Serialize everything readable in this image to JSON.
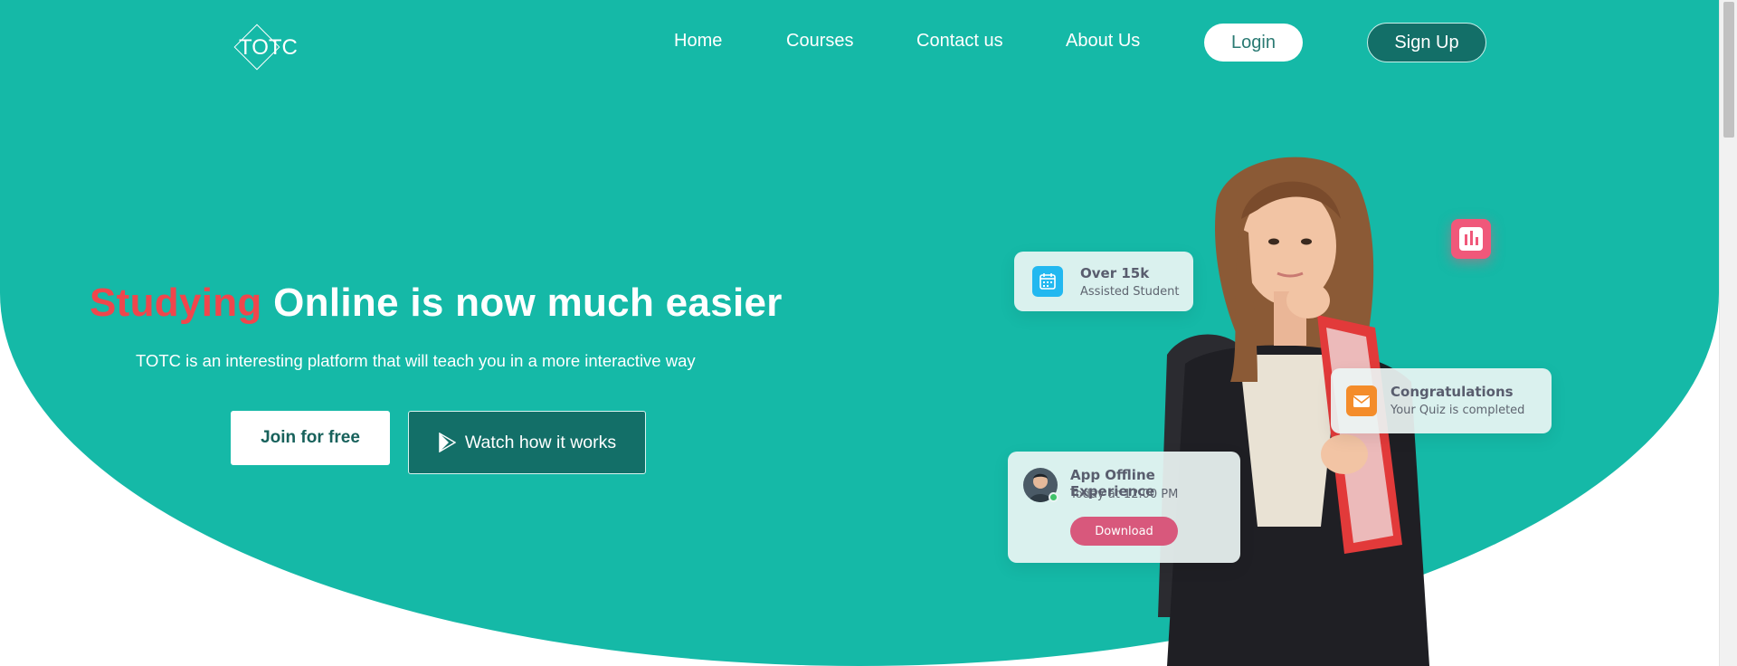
{
  "nav": {
    "logo_text": "TOTC",
    "links": [
      "Home",
      "Courses",
      "Contact us",
      "About Us"
    ],
    "login_label": "Login",
    "signup_label": "Sign Up"
  },
  "hero": {
    "headline_accent": "Studying",
    "headline_rest": "Online is now much easier",
    "subline": "TOTC is an interesting platform that will teach you in a more interactive way",
    "join_label": "Join for free",
    "watch_label": "Watch how it works"
  },
  "cards": {
    "students": {
      "title": "Over 15k",
      "sub": "Assisted Student",
      "icon": "calendar-icon"
    },
    "congrats": {
      "title": "Congratulations",
      "sub": "Your Quiz is completed",
      "icon": "mail-icon"
    },
    "offline": {
      "title": "App Offline Experience",
      "sub": "Today at 12.00 PM",
      "button": "Download"
    },
    "badge": {
      "icon": "bar-chart-icon"
    }
  },
  "colors": {
    "hero_bg": "#15b9a7",
    "accent_red": "#f0464c",
    "dark_teal": "#136f68",
    "download_pink": "#d8587c"
  }
}
